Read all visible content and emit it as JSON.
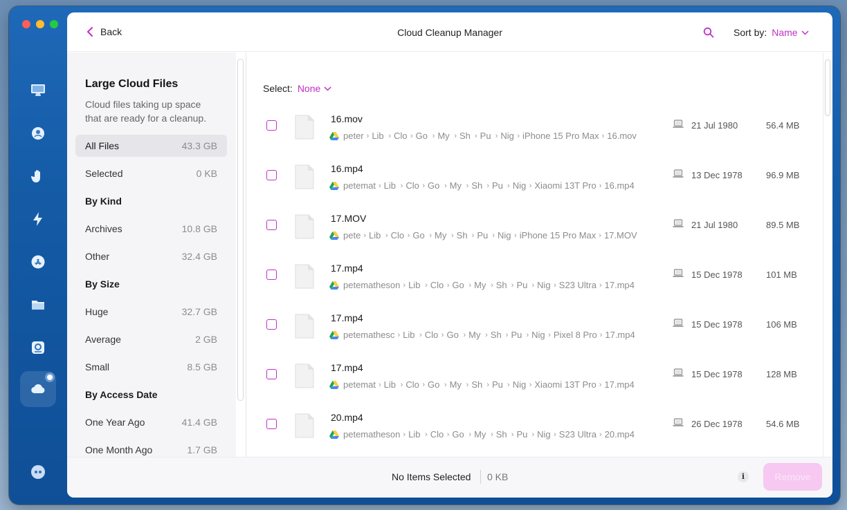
{
  "header": {
    "back_label": "Back",
    "title": "Cloud Cleanup Manager",
    "sort_label": "Sort by:",
    "sort_value": "Name"
  },
  "sidebar": {
    "title": "Large Cloud Files",
    "subtitle": "Cloud files taking up space that are ready for a cleanup.",
    "rows": [
      {
        "label": "All Files",
        "size": "43.3 GB",
        "kind": "item",
        "active": true
      },
      {
        "label": "Selected",
        "size": "0 KB",
        "kind": "item"
      },
      {
        "label": "By Kind",
        "size": "",
        "kind": "heading"
      },
      {
        "label": "Archives",
        "size": "10.8 GB",
        "kind": "item"
      },
      {
        "label": "Other",
        "size": "32.4 GB",
        "kind": "item"
      },
      {
        "label": "By Size",
        "size": "",
        "kind": "heading"
      },
      {
        "label": "Huge",
        "size": "32.7 GB",
        "kind": "item"
      },
      {
        "label": "Average",
        "size": "2 GB",
        "kind": "item"
      },
      {
        "label": "Small",
        "size": "8.5 GB",
        "kind": "item"
      },
      {
        "label": "By Access Date",
        "size": "",
        "kind": "heading"
      },
      {
        "label": "One Year Ago",
        "size": "41.4 GB",
        "kind": "item"
      },
      {
        "label": "One Month Ago",
        "size": "1.7 GB",
        "kind": "item"
      }
    ]
  },
  "select": {
    "label": "Select:",
    "value": "None"
  },
  "files": [
    {
      "name": "16.mov",
      "path": [
        "peter",
        "Lib",
        "Clo",
        "Go",
        "My",
        "Sh",
        "Pu",
        "Nig",
        "iPhone 15 Pro Max",
        "16.mov"
      ],
      "date": "21 Jul 1980",
      "size": "56.4 MB"
    },
    {
      "name": "16.mp4",
      "path": [
        "petemat",
        "Lib",
        "Clo",
        "Go",
        "My",
        "Sh",
        "Pu",
        "Nig",
        "Xiaomi 13T Pro",
        "16.mp4"
      ],
      "date": "13 Dec 1978",
      "size": "96.9 MB"
    },
    {
      "name": "17.MOV",
      "path": [
        "pete",
        "Lib",
        "Clo",
        "Go",
        "My",
        "Sh",
        "Pu",
        "Nig",
        "iPhone 15 Pro Max",
        "17.MOV"
      ],
      "date": "21 Jul 1980",
      "size": "89.5 MB"
    },
    {
      "name": "17.mp4",
      "path": [
        "petematheson",
        "Lib",
        "Clo",
        "Go",
        "My",
        "Sh",
        "Pu",
        "Nig",
        "S23 Ultra",
        "17.mp4"
      ],
      "date": "15 Dec 1978",
      "size": "101 MB"
    },
    {
      "name": "17.mp4",
      "path": [
        "petemathesc",
        "Lib",
        "Clo",
        "Go",
        "My",
        "Sh",
        "Pu",
        "Nig",
        "Pixel 8 Pro",
        "17.mp4"
      ],
      "date": "15 Dec 1978",
      "size": "106 MB"
    },
    {
      "name": "17.mp4",
      "path": [
        "petemat",
        "Lib",
        "Clo",
        "Go",
        "My",
        "Sh",
        "Pu",
        "Nig",
        "Xiaomi 13T Pro",
        "17.mp4"
      ],
      "date": "15 Dec 1978",
      "size": "128 MB"
    },
    {
      "name": "20.mp4",
      "path": [
        "petematheson",
        "Lib",
        "Clo",
        "Go",
        "My",
        "Sh",
        "Pu",
        "Nig",
        "S23 Ultra",
        "20.mp4"
      ],
      "date": "26 Dec 1978",
      "size": "54.6 MB"
    }
  ],
  "footer": {
    "status": "No Items Selected",
    "size": "0 KB",
    "info_glyph": "i",
    "remove_label": "Remove"
  },
  "colors": {
    "accent": "#c02fc7",
    "window_bg": "#145aa5",
    "remove_disabled": "#f7c8f2"
  },
  "rail_icons": [
    "imac-icon",
    "privacy-ball-icon",
    "hand-icon",
    "lightning-icon",
    "app-store-icon",
    "folder-icon",
    "disk-search-icon",
    "cloud-icon",
    "assistant-icon"
  ]
}
